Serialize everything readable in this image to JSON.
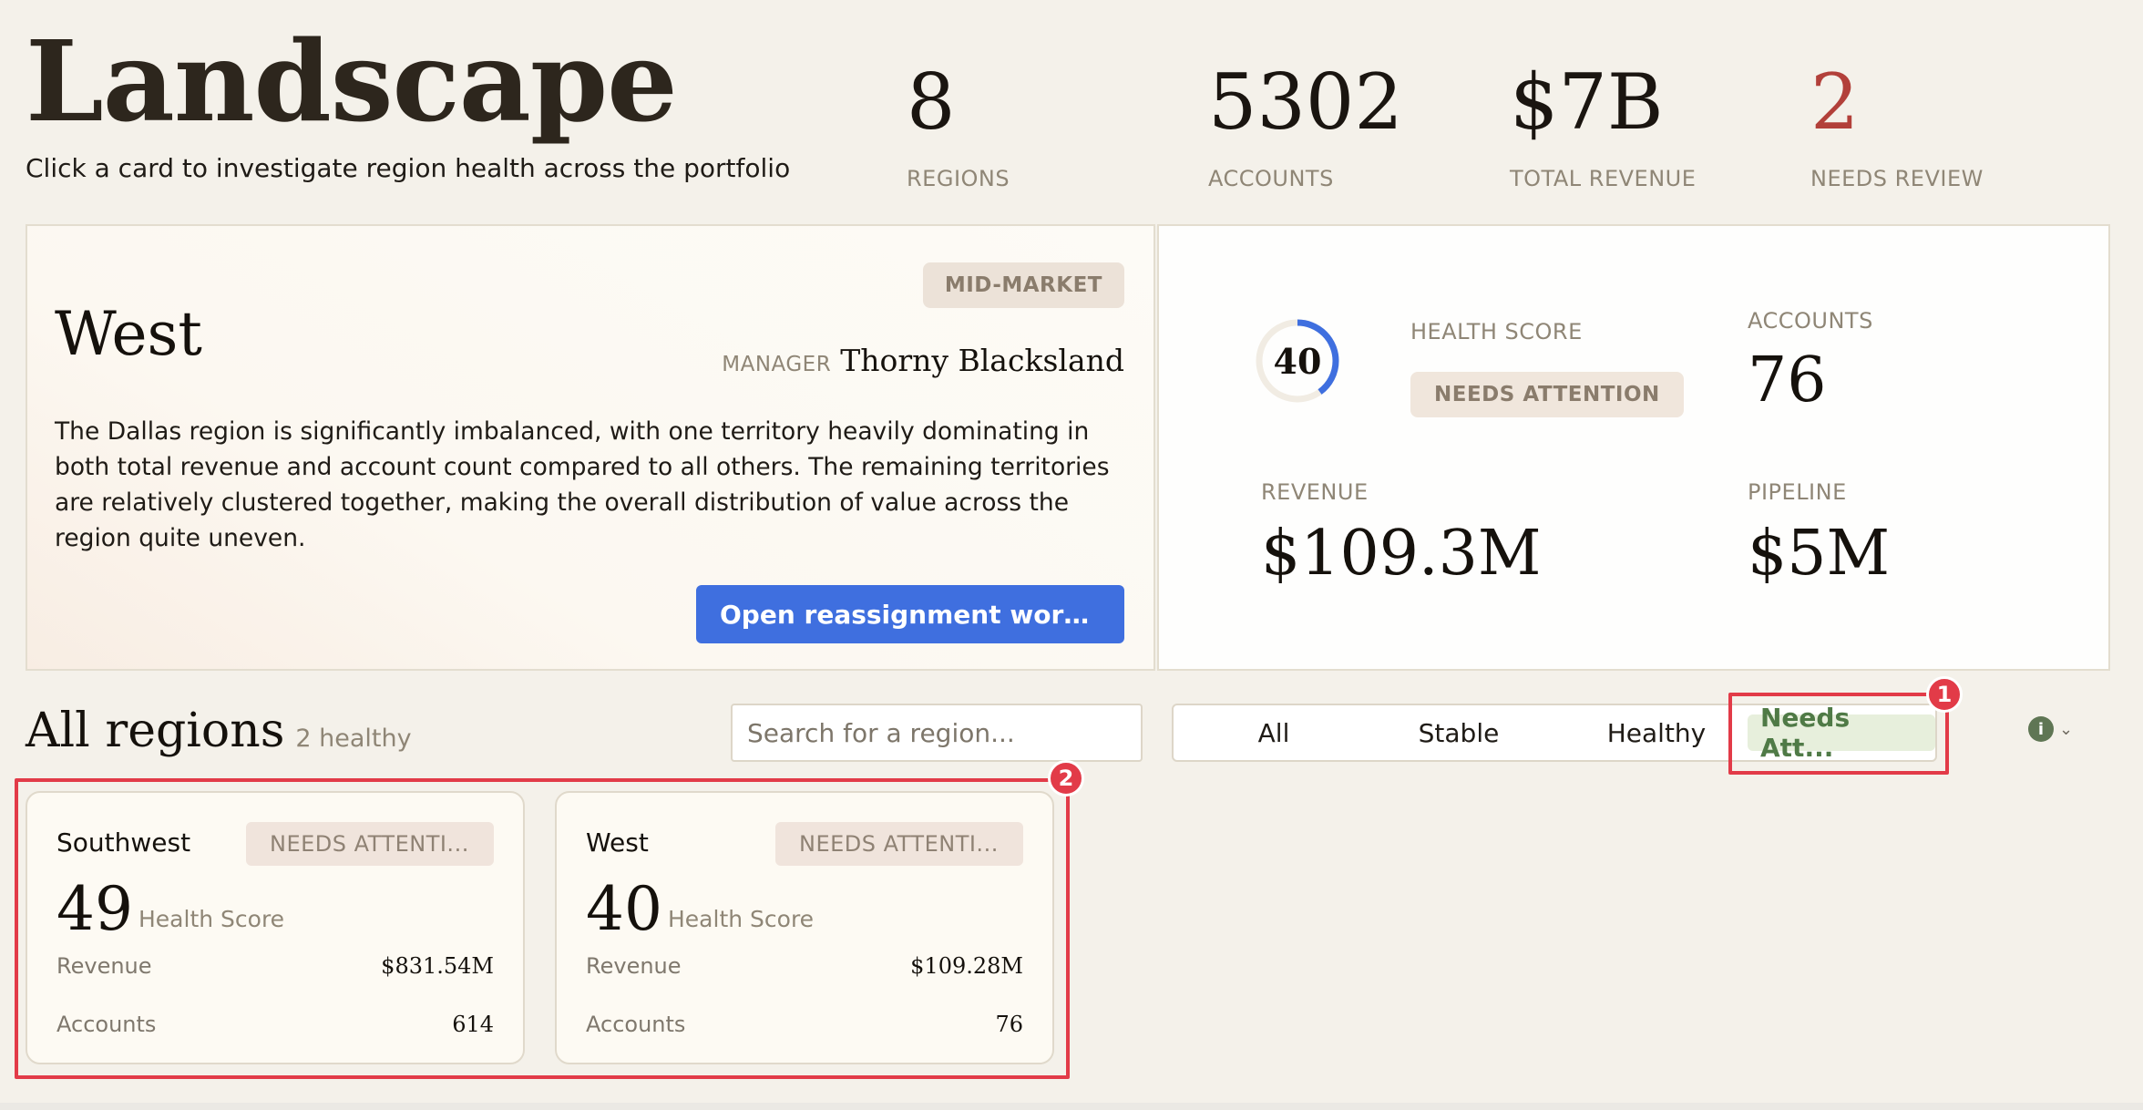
{
  "header": {
    "title": "Landscape",
    "subtitle": "Click a card to investigate region health across the portfolio",
    "stats": [
      {
        "value": "8",
        "label": "REGIONS"
      },
      {
        "value": "5302",
        "label": "ACCOUNTS"
      },
      {
        "value": "$7B",
        "label": "TOTAL REVENUE"
      },
      {
        "value": "2",
        "label": "NEEDS REVIEW"
      }
    ]
  },
  "detail": {
    "segment": "MID-MARKET",
    "region": "West",
    "manager_label": "MANAGER",
    "manager_name": "Thorny Blacksland",
    "description": "The Dallas region is significantly imbalanced, with one territory heavily dominating in both total revenue and account count compared to all others. The remaining territories are relatively clustered together, making the overall distribution of value across the region quite uneven.",
    "action_label": "Open reassignment workspa...",
    "health_score": "40",
    "health_score_fraction": 0.4,
    "health_label": "HEALTH SCORE",
    "status": "NEEDS ATTENTION",
    "accounts_label": "ACCOUNTS",
    "accounts": "76",
    "revenue_label": "REVENUE",
    "revenue": "$109.3M",
    "pipeline_label": "PIPELINE",
    "pipeline": "$5M"
  },
  "regions": {
    "title": "All regions",
    "count": "2 healthy",
    "search_placeholder": "Search for a region...",
    "filters": [
      "All",
      "Stable",
      "Healthy",
      "Needs Att..."
    ],
    "active_filter": "Needs Att...",
    "cards": [
      {
        "name": "Southwest",
        "badge": "NEEDS ATTENTI...",
        "score": "49",
        "score_label": "Health Score",
        "revenue_label": "Revenue",
        "revenue": "$831.54M",
        "accounts_label": "Accounts",
        "accounts": "614"
      },
      {
        "name": "West",
        "badge": "NEEDS ATTENTI...",
        "score": "40",
        "score_label": "Health Score",
        "revenue_label": "Revenue",
        "revenue": "$109.28M",
        "accounts_label": "Accounts",
        "accounts": "76"
      }
    ]
  },
  "annotations": {
    "mark1": "1",
    "mark2": "2"
  },
  "colors": {
    "accent": "#3f6fdf",
    "alert": "#b2403a",
    "ring_track": "#f1ece3",
    "active_filter_bg": "#e7efdc",
    "active_filter_text": "#4f7a46",
    "annotation": "#e23b48"
  },
  "icons": {
    "info": "info-circle-icon",
    "chevron": "chevron-down-icon"
  }
}
